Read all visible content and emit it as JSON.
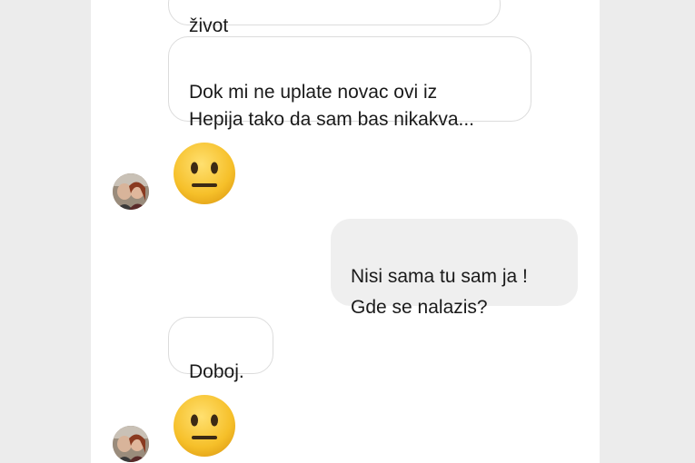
{
  "conversation": {
    "messages": [
      {
        "sender": "other",
        "type": "text",
        "text": "život"
      },
      {
        "sender": "other",
        "type": "text",
        "text": "Dok mi ne uplate novac ovi iz\nHepija tako da sam bas nikakva..."
      },
      {
        "sender": "other",
        "type": "emoji",
        "emoji": "neutral-face"
      },
      {
        "sender": "me",
        "type": "text",
        "text": "Nisi sama tu sam ja !\nGde se nalazis?"
      },
      {
        "sender": "other",
        "type": "text",
        "text": "Doboj."
      },
      {
        "sender": "other",
        "type": "emoji",
        "emoji": "neutral-face"
      }
    ]
  },
  "colors": {
    "incoming_bubble": "#ffffff",
    "incoming_border": "#dcdcdc",
    "outgoing_bubble": "#efefef",
    "text": "#1a1a1a",
    "emoji_face": "#f6c02a"
  }
}
